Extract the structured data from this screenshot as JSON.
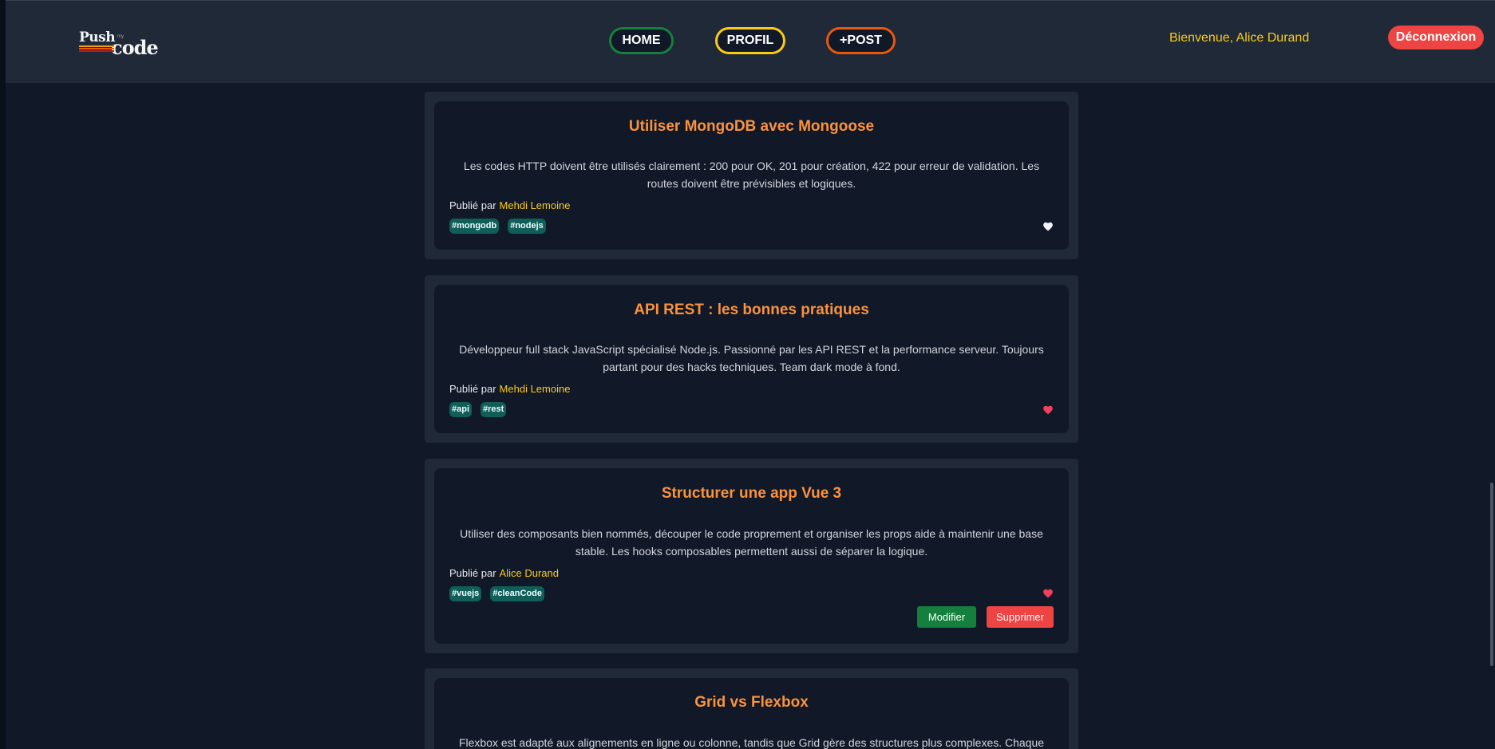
{
  "header": {
    "logo": {
      "word1": "Push",
      "word2": "my",
      "word3": "code"
    },
    "nav": [
      {
        "label": "HOME",
        "color": "#15803d"
      },
      {
        "label": "PROFIL",
        "color": "#facc15"
      },
      {
        "label": "+POST",
        "color": "#ea580c"
      }
    ],
    "welcome": "Bienvenue, Alice Durand",
    "logout_label": "Déconnexion"
  },
  "posts": [
    {
      "title": "Utiliser MongoDB avec Mongoose",
      "content": "Les codes HTTP doivent être utilisés clairement : 200 pour OK, 201 pour création, 422 pour erreur de validation. Les routes doivent être prévisibles et logiques.",
      "byline_prefix": "Publié par",
      "author": "Mehdi Lemoine",
      "tags": [
        "#mongodb",
        "#nodejs"
      ],
      "liked": false
    },
    {
      "title": "API REST : les bonnes pratiques",
      "content": "Développeur full stack JavaScript spécialisé Node.js. Passionné par les API REST et la performance serveur. Toujours partant pour des hacks techniques. Team dark mode à fond.",
      "byline_prefix": "Publié par",
      "author": "Mehdi Lemoine",
      "tags": [
        "#api",
        "#rest"
      ],
      "liked": true
    },
    {
      "title": "Structurer une app Vue 3",
      "content": "Utiliser des composants bien nommés, découper le code proprement et organiser les props aide à maintenir une base stable. Les hooks composables permettent aussi de séparer la logique.",
      "byline_prefix": "Publié par",
      "author": "Alice Durand",
      "tags": [
        "#vuejs",
        "#cleanCode"
      ],
      "liked": true,
      "edit_label": "Modifier",
      "delete_label": "Supprimer"
    },
    {
      "title": "Grid vs Flexbox",
      "content": "Flexbox est adapté aux alignements en ligne ou colonne, tandis que Grid gère des structures plus complexes. Chaque"
    }
  ],
  "colors": {
    "accent": "#fb923c",
    "author": "#facc15",
    "tag_bg": "#115e59",
    "liked": "#f43f5e",
    "unliked": "#f3f4f6",
    "edit": "#15803d",
    "delete": "#ef4444"
  }
}
